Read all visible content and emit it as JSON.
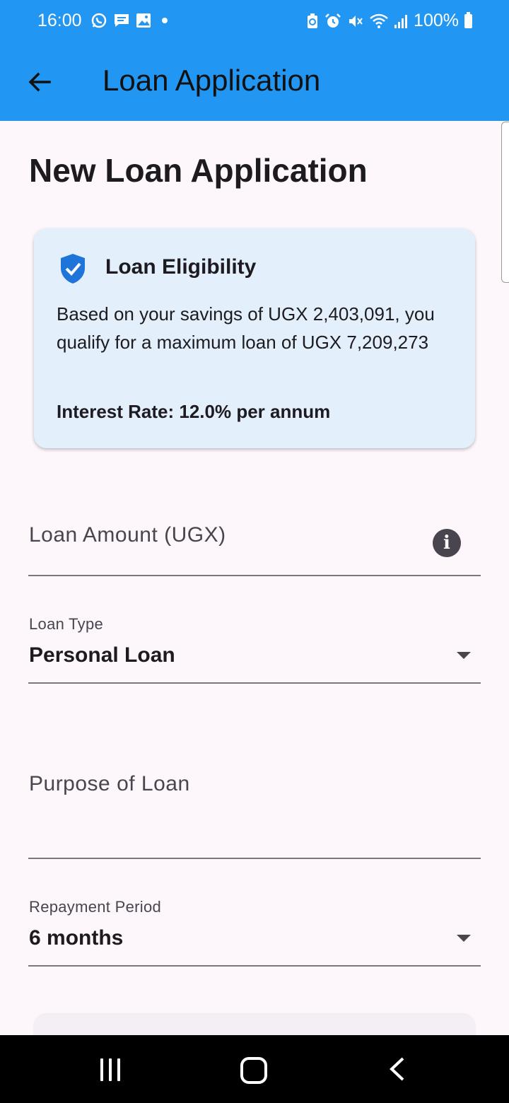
{
  "status_bar": {
    "time": "16:00",
    "battery": "100%",
    "left_icons": [
      "whatsapp-icon",
      "message-icon",
      "gallery-icon",
      "dot-icon"
    ],
    "right_icons": [
      "battery-saver-icon",
      "alarm-icon",
      "mute-icon",
      "wifi-icon",
      "signal-icon"
    ]
  },
  "app_bar": {
    "title": "Loan Application"
  },
  "page": {
    "title": "New Loan Application"
  },
  "eligibility_card": {
    "title": "Loan Eligibility",
    "body": "Based on your savings of UGX 2,403,091, you qualify for a maximum loan of UGX 7,209,273",
    "interest_rate": "Interest Rate: 12.0% per annum"
  },
  "form": {
    "loan_amount": {
      "placeholder": "Loan Amount (UGX)",
      "value": ""
    },
    "loan_type": {
      "label": "Loan Type",
      "value": "Personal Loan"
    },
    "purpose": {
      "placeholder": "Purpose of Loan",
      "value": ""
    },
    "repayment_period": {
      "label": "Repayment Period",
      "value": "6 months"
    }
  },
  "colors": {
    "app_bar": "#2196F3",
    "card_background": "#E3F0FB",
    "page_background": "#FDF7FC",
    "shield": "#1E74D8"
  }
}
